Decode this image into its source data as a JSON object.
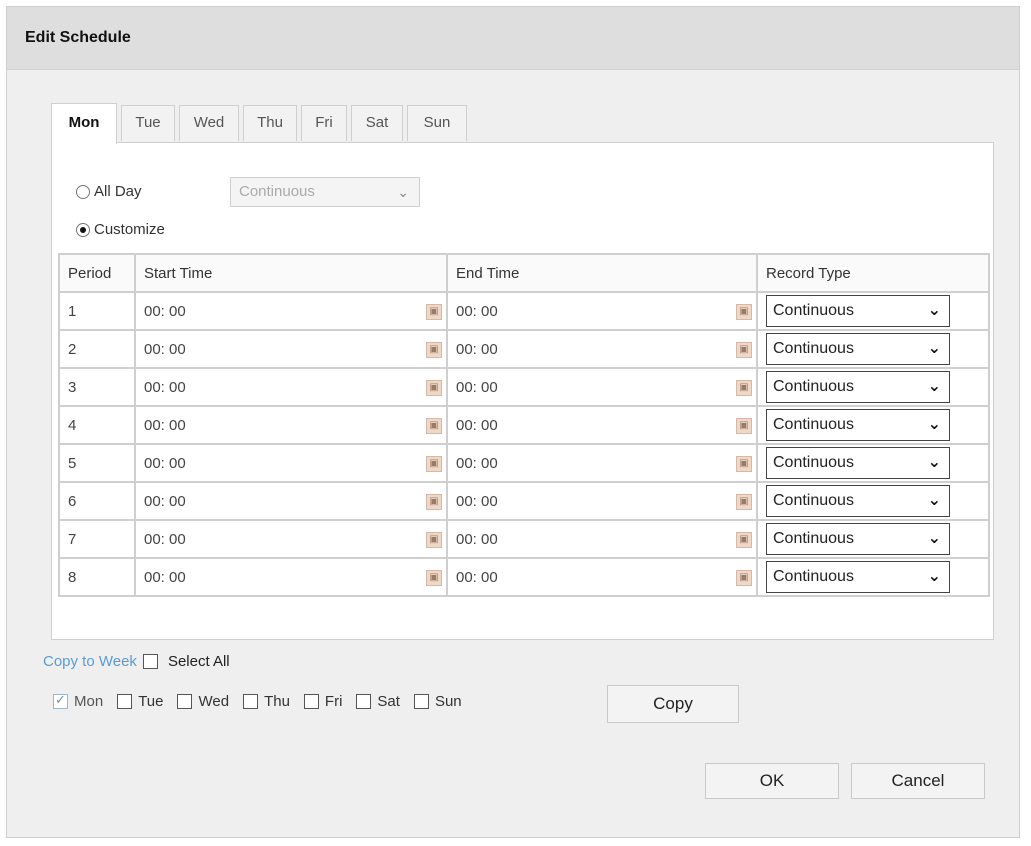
{
  "dialog": {
    "title": "Edit Schedule"
  },
  "tabs": [
    "Mon",
    "Tue",
    "Wed",
    "Thu",
    "Fri",
    "Sat",
    "Sun"
  ],
  "active_tab": "Mon",
  "mode": {
    "all_day_label": "All Day",
    "customize_label": "Customize",
    "selected": "Customize",
    "all_day_type": "Continuous"
  },
  "table": {
    "headers": [
      "Period",
      "Start Time",
      "End Time",
      "Record Type"
    ],
    "rows": [
      {
        "period": "1",
        "start": "00: 00",
        "end": "00: 00",
        "type": "Continuous"
      },
      {
        "period": "2",
        "start": "00: 00",
        "end": "00: 00",
        "type": "Continuous"
      },
      {
        "period": "3",
        "start": "00: 00",
        "end": "00: 00",
        "type": "Continuous"
      },
      {
        "period": "4",
        "start": "00: 00",
        "end": "00: 00",
        "type": "Continuous"
      },
      {
        "period": "5",
        "start": "00: 00",
        "end": "00: 00",
        "type": "Continuous"
      },
      {
        "period": "6",
        "start": "00: 00",
        "end": "00: 00",
        "type": "Continuous"
      },
      {
        "period": "7",
        "start": "00: 00",
        "end": "00: 00",
        "type": "Continuous"
      },
      {
        "period": "8",
        "start": "00: 00",
        "end": "00: 00",
        "type": "Continuous"
      }
    ]
  },
  "copy": {
    "copy_to_week_label": "Copy to Week",
    "select_all_label": "Select All",
    "days": [
      {
        "label": "Mon",
        "checked": true
      },
      {
        "label": "Tue",
        "checked": false
      },
      {
        "label": "Wed",
        "checked": false
      },
      {
        "label": "Thu",
        "checked": false
      },
      {
        "label": "Fri",
        "checked": false
      },
      {
        "label": "Sat",
        "checked": false
      },
      {
        "label": "Sun",
        "checked": false
      }
    ],
    "copy_button_label": "Copy"
  },
  "footer": {
    "ok_label": "OK",
    "cancel_label": "Cancel"
  },
  "icons": {
    "time_picker": "clock-picker-icon",
    "dropdown": "chevron-down-icon"
  }
}
